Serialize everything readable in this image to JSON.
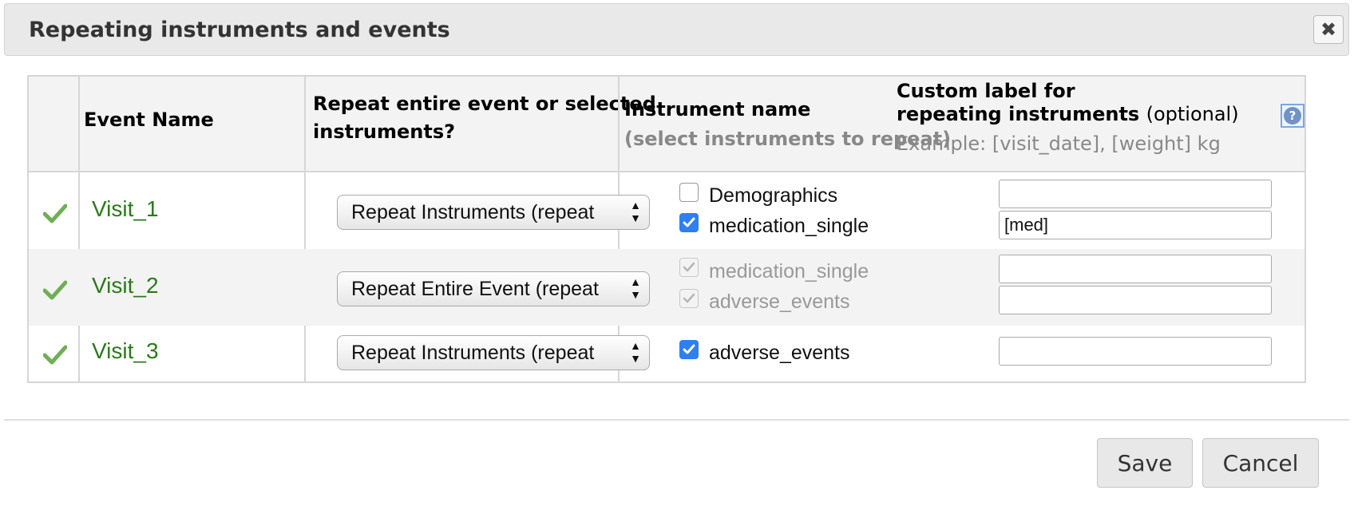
{
  "dialog": {
    "title": "Repeating instruments and events",
    "close_icon": "close-icon"
  },
  "table": {
    "headers": {
      "event_name": "Event Name",
      "repeat_line1": "Repeat entire event or selected",
      "repeat_line2": "instruments?",
      "instrument_name": "Instrument name",
      "instrument_hint": "(select instruments to repeat)",
      "custom_label_line1": "Custom label for",
      "custom_label_line2_bold": "repeating instruments",
      "custom_label_optional": "(optional)",
      "custom_label_example": "Example: [visit_date], [weight] kg",
      "help_icon": "help-icon"
    },
    "rows": [
      {
        "status_icon": "check-icon",
        "event": "Visit_1",
        "repeat_mode": "Repeat Instruments (repeat",
        "instruments": [
          {
            "name": "Demographics",
            "checked": false,
            "disabled": false,
            "label": ""
          },
          {
            "name": "medication_single",
            "checked": true,
            "disabled": false,
            "label": "[med]"
          }
        ]
      },
      {
        "status_icon": "check-icon",
        "event": "Visit_2",
        "repeat_mode": "Repeat Entire Event (repeat",
        "instruments": [
          {
            "name": "medication_single",
            "checked": true,
            "disabled": true,
            "label": ""
          },
          {
            "name": "adverse_events",
            "checked": true,
            "disabled": true,
            "label": ""
          }
        ]
      },
      {
        "status_icon": "check-icon",
        "event": "Visit_3",
        "repeat_mode": "Repeat Instruments (repeat",
        "instruments": [
          {
            "name": "adverse_events",
            "checked": true,
            "disabled": false,
            "label": ""
          }
        ]
      }
    ]
  },
  "footer": {
    "save_label": "Save",
    "cancel_label": "Cancel"
  },
  "colors": {
    "event_link": "#2a7a1a",
    "checkbox_checked": "#2f7ef2",
    "disabled_text": "#999999",
    "header_bg": "#f3f3f3"
  }
}
